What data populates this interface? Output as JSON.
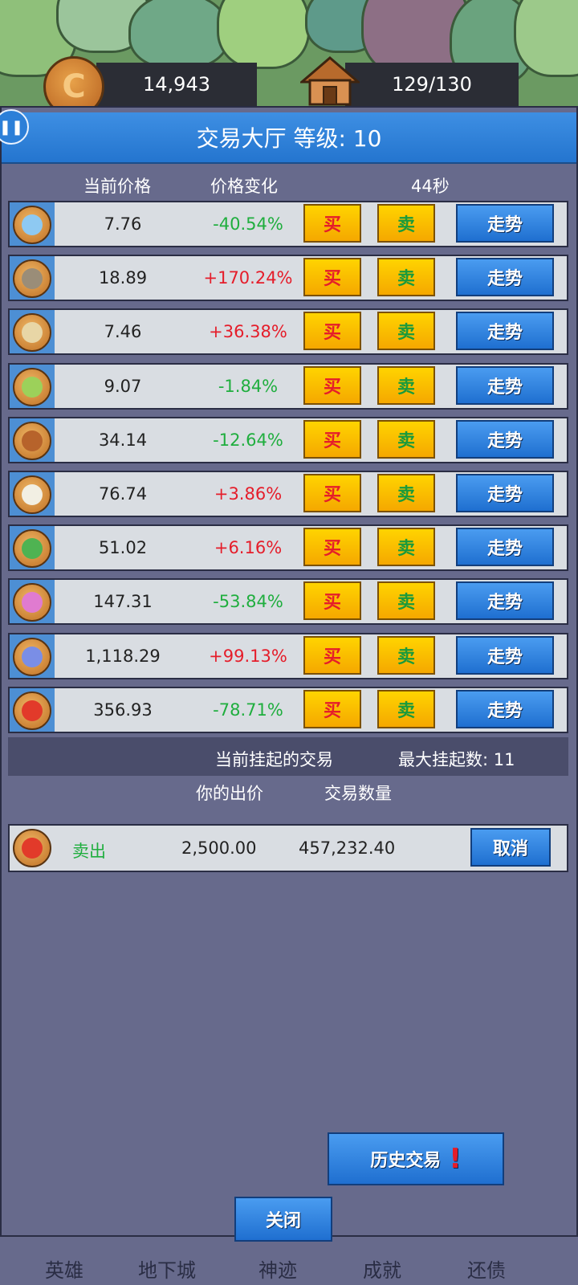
{
  "resources": {
    "coins": "14,943",
    "coin_symbol": "C",
    "population": "129/130"
  },
  "panel": {
    "title": "交易大厅 等级: 10",
    "pause_symbol": "❚❚"
  },
  "columns": {
    "price": "当前价格",
    "change": "价格变化",
    "timer": "44秒"
  },
  "labels": {
    "buy": "买",
    "sell": "卖",
    "trend": "走势"
  },
  "market": [
    {
      "price": "7.76",
      "change": "-40.54%",
      "dir": "down",
      "icon": "slime-icon"
    },
    {
      "price": "18.89",
      "change": "+170.24%",
      "dir": "up",
      "icon": "zombie-icon"
    },
    {
      "price": "7.46",
      "change": "+36.38%",
      "dir": "up",
      "icon": "skull-icon"
    },
    {
      "price": "9.07",
      "change": "-1.84%",
      "dir": "down",
      "icon": "goblin-icon"
    },
    {
      "price": "34.14",
      "change": "-12.64%",
      "dir": "down",
      "icon": "treant-icon"
    },
    {
      "price": "76.74",
      "change": "+3.86%",
      "dir": "up",
      "icon": "wolf-icon"
    },
    {
      "price": "51.02",
      "change": "+6.16%",
      "dir": "up",
      "icon": "orc-icon"
    },
    {
      "price": "147.31",
      "change": "-53.84%",
      "dir": "down",
      "icon": "mushroom-icon"
    },
    {
      "price": "1,118.29",
      "change": "+99.13%",
      "dir": "up",
      "icon": "fish-monster-icon"
    },
    {
      "price": "356.93",
      "change": "-78.71%",
      "dir": "down",
      "icon": "dragon-icon"
    }
  ],
  "pending": {
    "title": "当前挂起的交易",
    "max_label": "最大挂起数: 11",
    "col_offer": "你的出价",
    "col_qty": "交易数量",
    "orders": [
      {
        "type": "卖出",
        "offer": "2,500.00",
        "qty": "457,232.40",
        "cancel": "取消",
        "icon": "dragon-icon"
      }
    ]
  },
  "buttons": {
    "history": "历史交易",
    "history_alert": "!",
    "close": "关闭"
  },
  "nav": [
    "英雄",
    "地下城",
    "神迹",
    "成就",
    "还债"
  ],
  "colors": {
    "up": "#e51d2a",
    "down": "#1fae3e",
    "accent_blue": "#2c7fd8",
    "button_yellow": "#ffd400"
  }
}
